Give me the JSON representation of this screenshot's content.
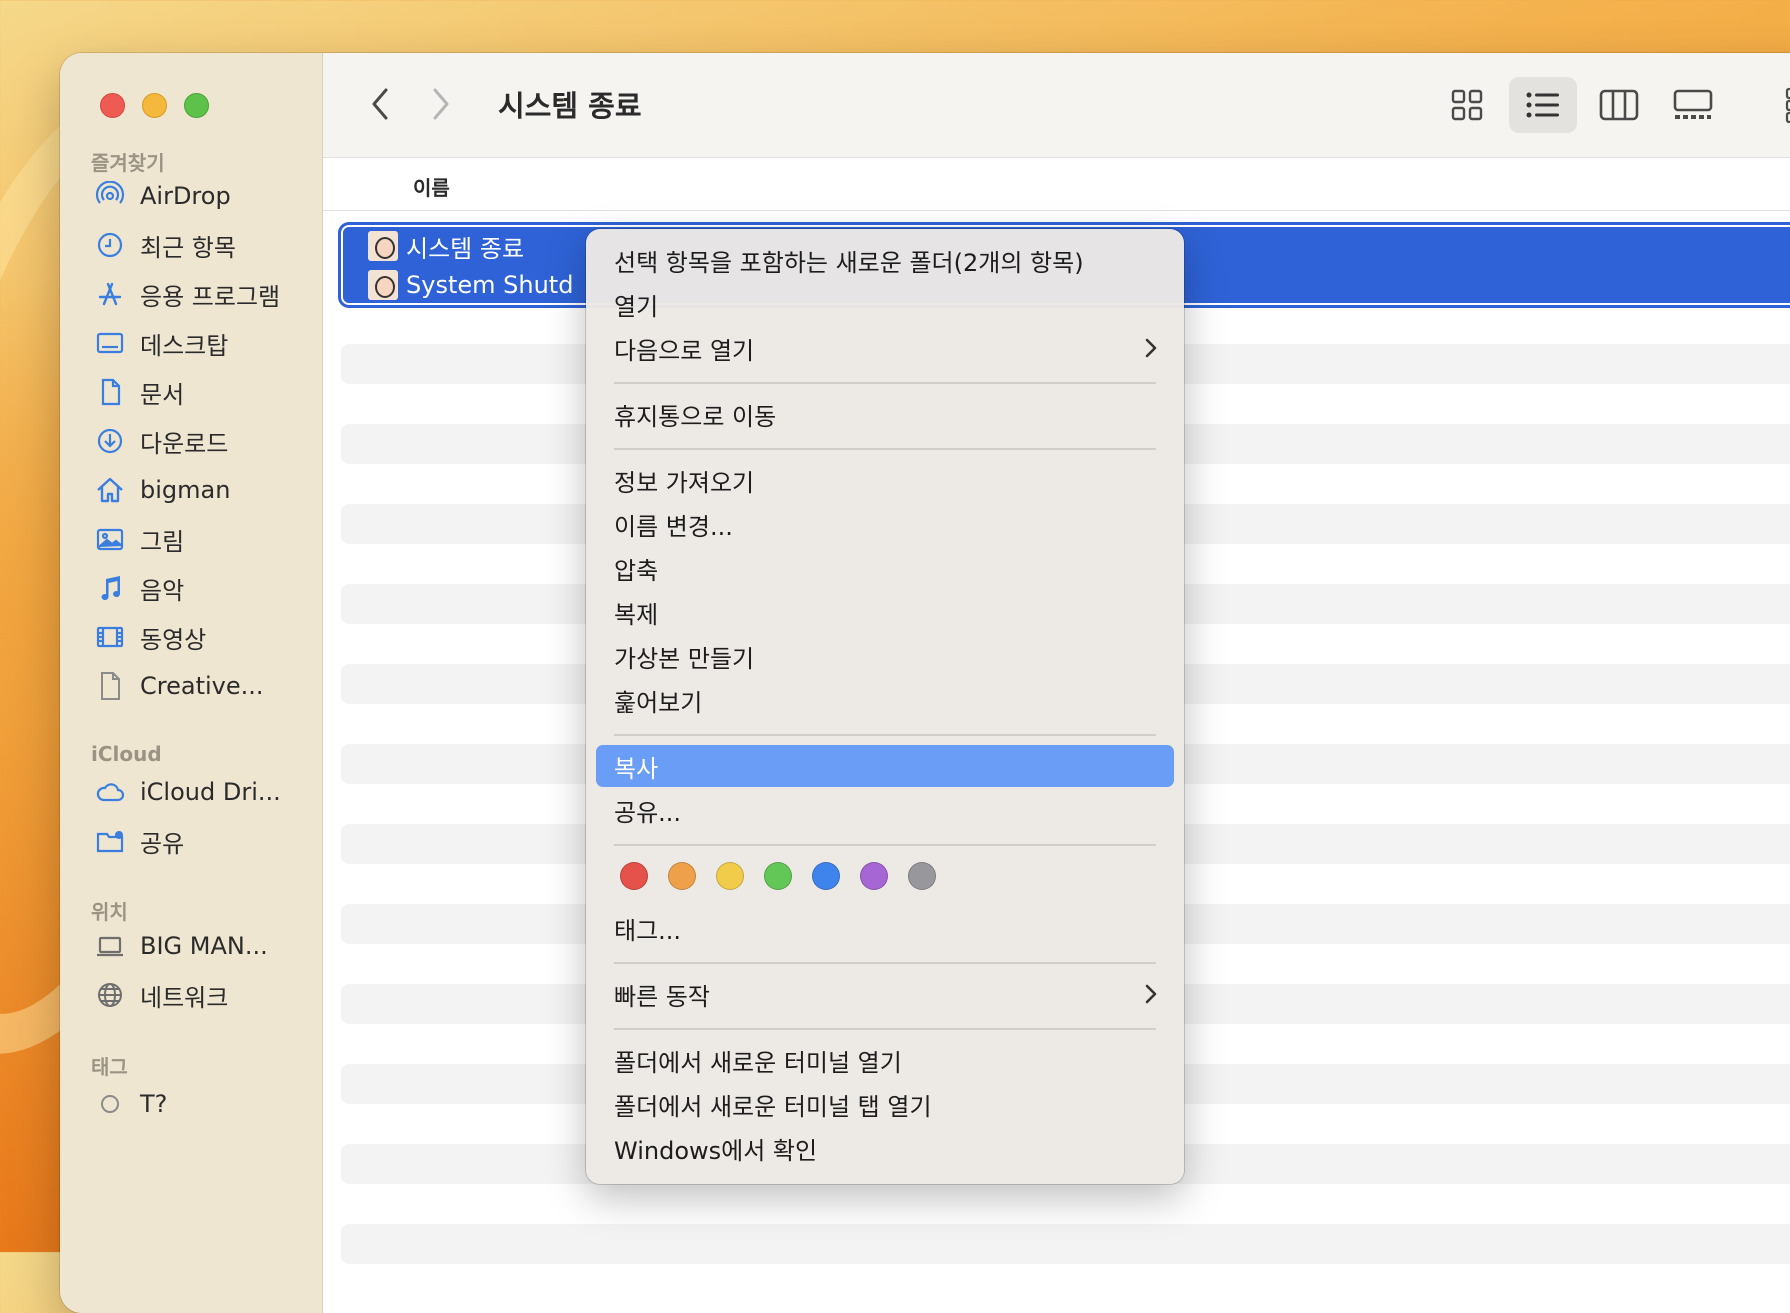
{
  "window": {
    "title": "시스템 종료"
  },
  "sidebar": {
    "favorites_header": "즐겨찾기",
    "favorites": [
      {
        "label": "AirDrop",
        "icon": "airdrop-icon"
      },
      {
        "label": "최근 항목",
        "icon": "clock-icon"
      },
      {
        "label": "응용 프로그램",
        "icon": "applications-icon"
      },
      {
        "label": "데스크탑",
        "icon": "desktop-icon"
      },
      {
        "label": "문서",
        "icon": "document-icon"
      },
      {
        "label": "다운로드",
        "icon": "download-icon"
      },
      {
        "label": "bigman",
        "icon": "home-icon"
      },
      {
        "label": "그림",
        "icon": "photo-icon"
      },
      {
        "label": "음악",
        "icon": "music-icon"
      },
      {
        "label": "동영상",
        "icon": "film-icon"
      },
      {
        "label": "Creative...",
        "icon": "file-icon"
      }
    ],
    "icloud_header": "iCloud",
    "icloud": [
      {
        "label": "iCloud Dri...",
        "icon": "cloud-icon"
      },
      {
        "label": "공유",
        "icon": "shared-folder-icon"
      }
    ],
    "locations_header": "위치",
    "locations": [
      {
        "label": "BIG MAN...",
        "icon": "laptop-icon"
      },
      {
        "label": "네트워크",
        "icon": "globe-icon"
      }
    ],
    "tags_header": "태그",
    "tags_partial": "T?"
  },
  "column_header": {
    "name": "이름"
  },
  "files": [
    {
      "name": "시스템 종료"
    },
    {
      "name": "System Shutd"
    }
  ],
  "context_menu": {
    "items_group1": [
      {
        "label": "선택 항목을 포함하는 새로운 폴더(2개의 항목)"
      },
      {
        "label": "열기"
      },
      {
        "label": "다음으로 열기",
        "submenu": true
      }
    ],
    "items_group2": [
      {
        "label": "휴지통으로 이동"
      }
    ],
    "items_group3": [
      {
        "label": "정보 가져오기"
      },
      {
        "label": "이름 변경..."
      },
      {
        "label": "압축"
      },
      {
        "label": "복제"
      },
      {
        "label": "가상본 만들기"
      },
      {
        "label": "훑어보기"
      }
    ],
    "items_group4": [
      {
        "label": "복사",
        "highlighted": true
      },
      {
        "label": "공유..."
      }
    ],
    "tag_colors": [
      "#e5514b",
      "#eea14a",
      "#f1cc4a",
      "#62c756",
      "#3f84ec",
      "#a666d3",
      "#98989c"
    ],
    "tags_label": "태그...",
    "items_group6": [
      {
        "label": "빠른 동작",
        "submenu": true
      }
    ],
    "items_group7": [
      {
        "label": "폴더에서 새로운 터미널 열기"
      },
      {
        "label": "폴더에서 새로운 터미널 탭 열기"
      },
      {
        "label": "Windows에서 확인"
      }
    ]
  },
  "colors": {
    "selection": "#2e62d6",
    "menu_highlight": "#6a9df6",
    "accent": "#2e6fe0"
  }
}
